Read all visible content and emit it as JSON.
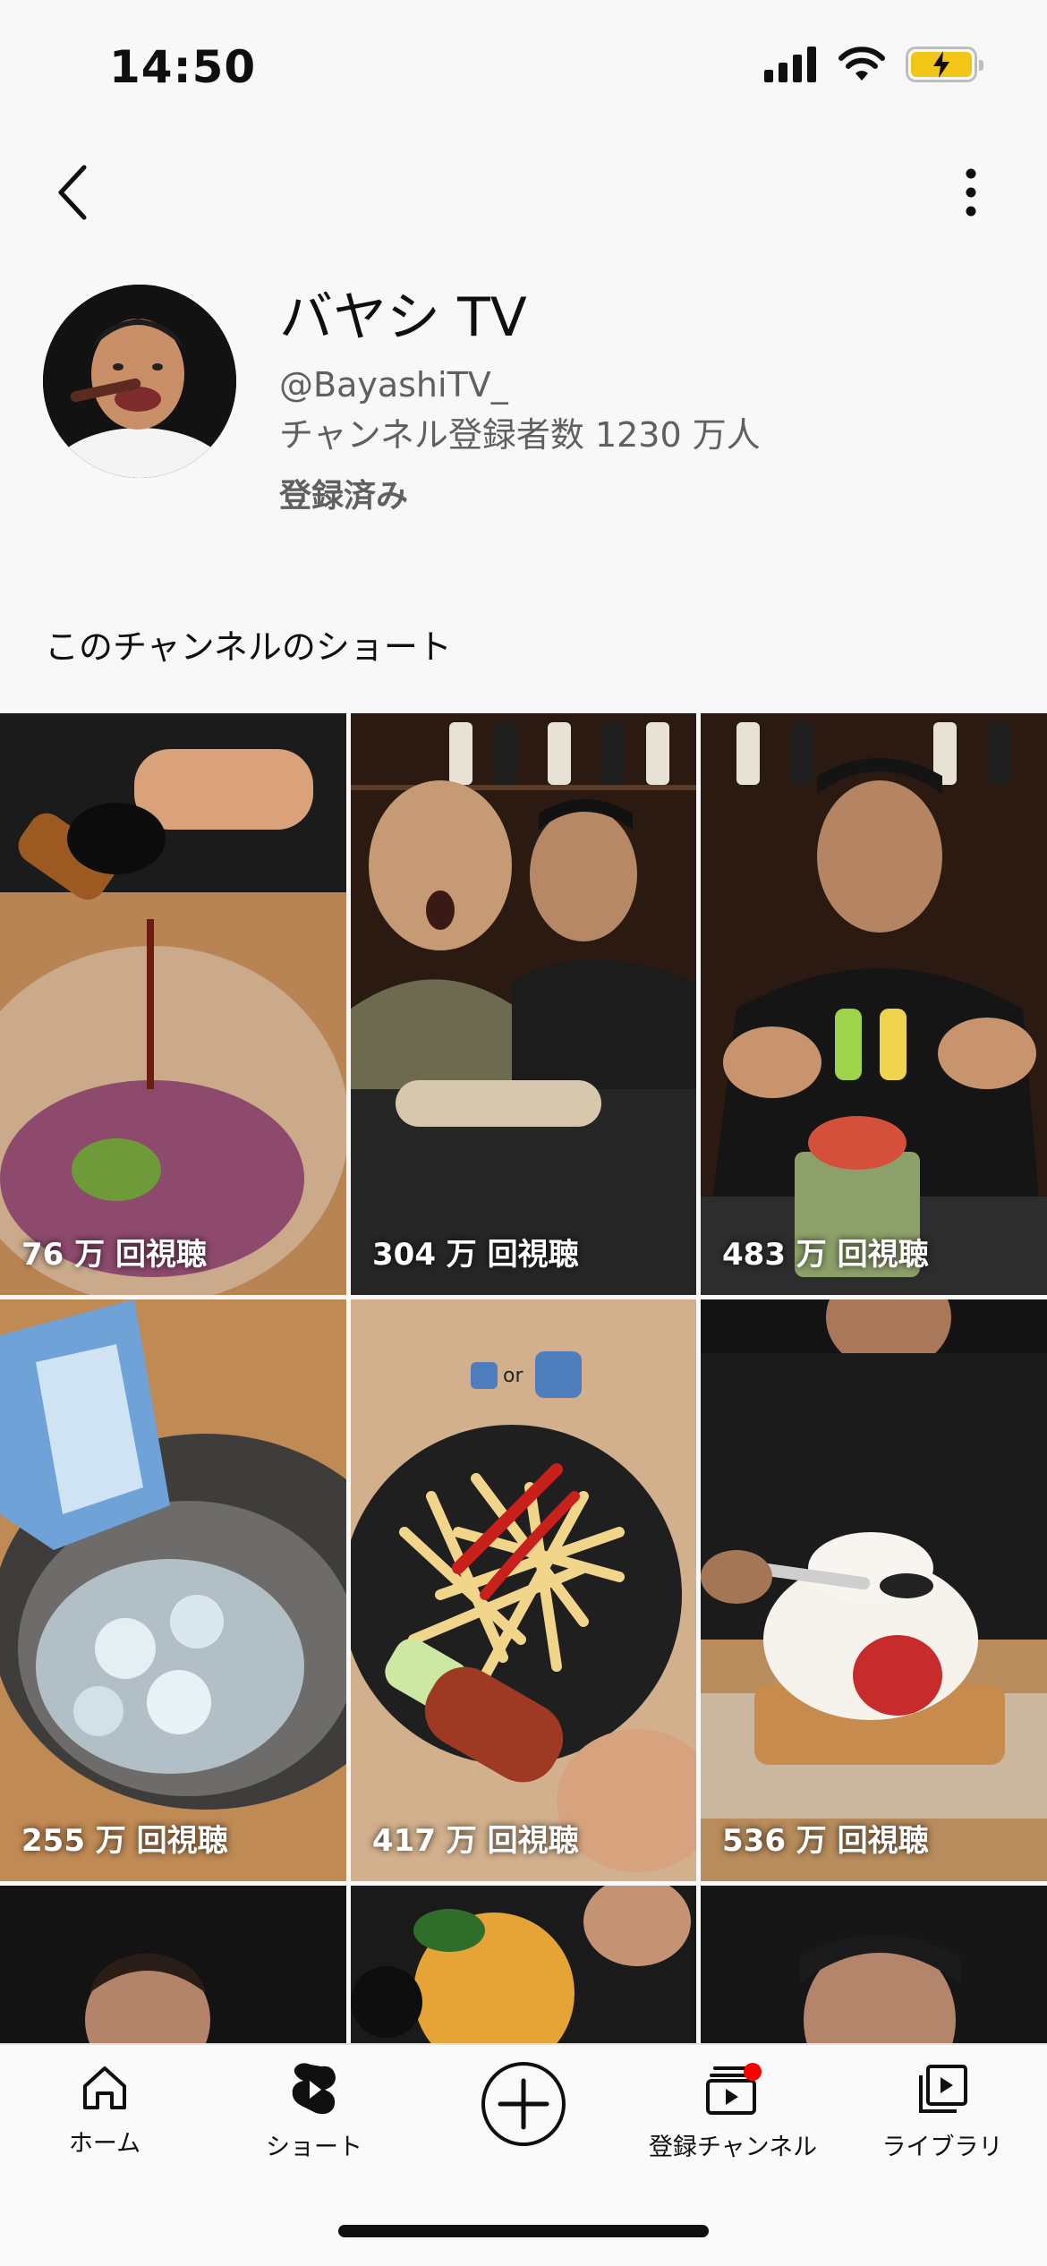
{
  "status_bar": {
    "time": "14:50",
    "battery_color": "#f2c617"
  },
  "header": {
    "back_icon": "chevron-left-icon",
    "more_icon": "vertical-ellipsis-icon"
  },
  "channel": {
    "name": "バヤシ TV",
    "handle": "@BayashiTV_",
    "subscribers": "チャンネル登録者数 1230 万人",
    "subscribed_label": "登録済み"
  },
  "shorts_section": {
    "title": "このチャンネルのショート",
    "items": [
      {
        "views": "76 万 回視聴"
      },
      {
        "views": "304 万 回視聴"
      },
      {
        "views": "483 万 回視聴"
      },
      {
        "views": "255 万 回視聴"
      },
      {
        "views": "417 万 回視聴",
        "overlay_text": "or"
      },
      {
        "views": "536 万 回視聴"
      },
      {
        "views": ""
      },
      {
        "views": ""
      },
      {
        "views": ""
      }
    ]
  },
  "tab_bar": {
    "tabs": [
      {
        "label": "ホーム",
        "icon": "home-icon"
      },
      {
        "label": "ショート",
        "icon": "shorts-icon"
      },
      {
        "label": "",
        "icon": "create-plus-icon"
      },
      {
        "label": "登録チャンネル",
        "icon": "subscriptions-icon",
        "badge_color": "#ff0000"
      },
      {
        "label": "ライブラリ",
        "icon": "library-icon"
      }
    ]
  }
}
